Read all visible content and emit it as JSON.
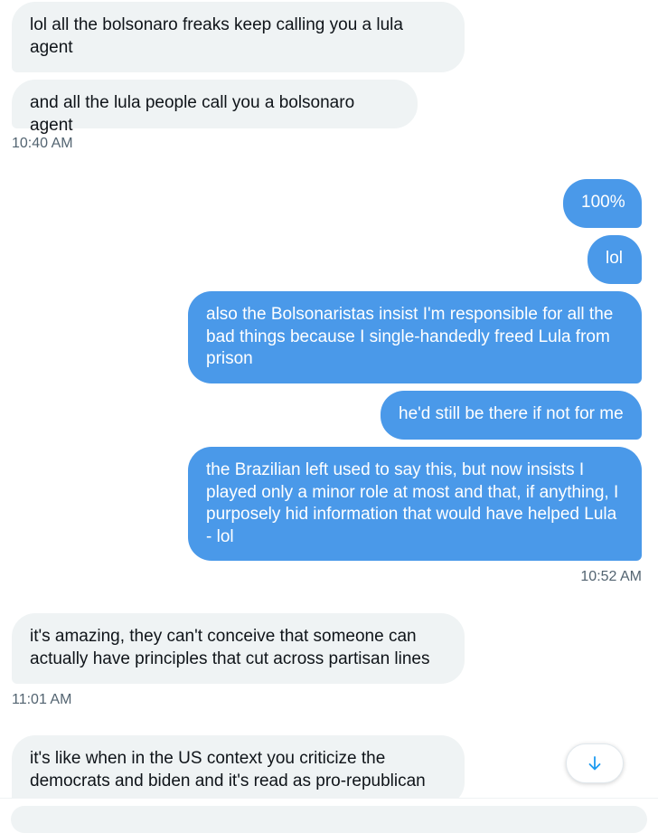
{
  "messages": [
    {
      "side": "received",
      "text": "lol all the bolsonaro freaks keep calling you a lula\nagent"
    },
    {
      "side": "received",
      "text": "and all the lula people call you a bolsonaro agent"
    },
    {
      "side": "sent",
      "text": "100%"
    },
    {
      "side": "sent",
      "text": "lol"
    },
    {
      "side": "sent",
      "text": "also the Bolsonaristas insist I'm responsible for all the\nbad things because I single-handedly freed Lula from\nprison"
    },
    {
      "side": "sent",
      "text": "he'd still be there if not for me"
    },
    {
      "side": "sent",
      "text": "the Brazilian left used to say this, but now insists I\nplayed only a minor role at most and that, if anything, I\npurposely hid information that would have helped Lula\n- lol"
    },
    {
      "side": "received",
      "text": "it's amazing, they can't conceive that someone can\nactually have principles that cut across partisan lines"
    },
    {
      "side": "received",
      "text": "it's like when in the US context you criticize the\ndemocrats and biden and it's read as pro-republican"
    }
  ],
  "timestamps": [
    "10:40 AM",
    "10:52 AM",
    "11:01 AM"
  ],
  "scroll_button": {
    "icon": "arrow-down-icon"
  },
  "colors": {
    "sent_bubble": "#4a99e9",
    "received_bubble": "#eff3f4",
    "timestamp_text": "#536471",
    "accent": "#1d9bf0"
  }
}
